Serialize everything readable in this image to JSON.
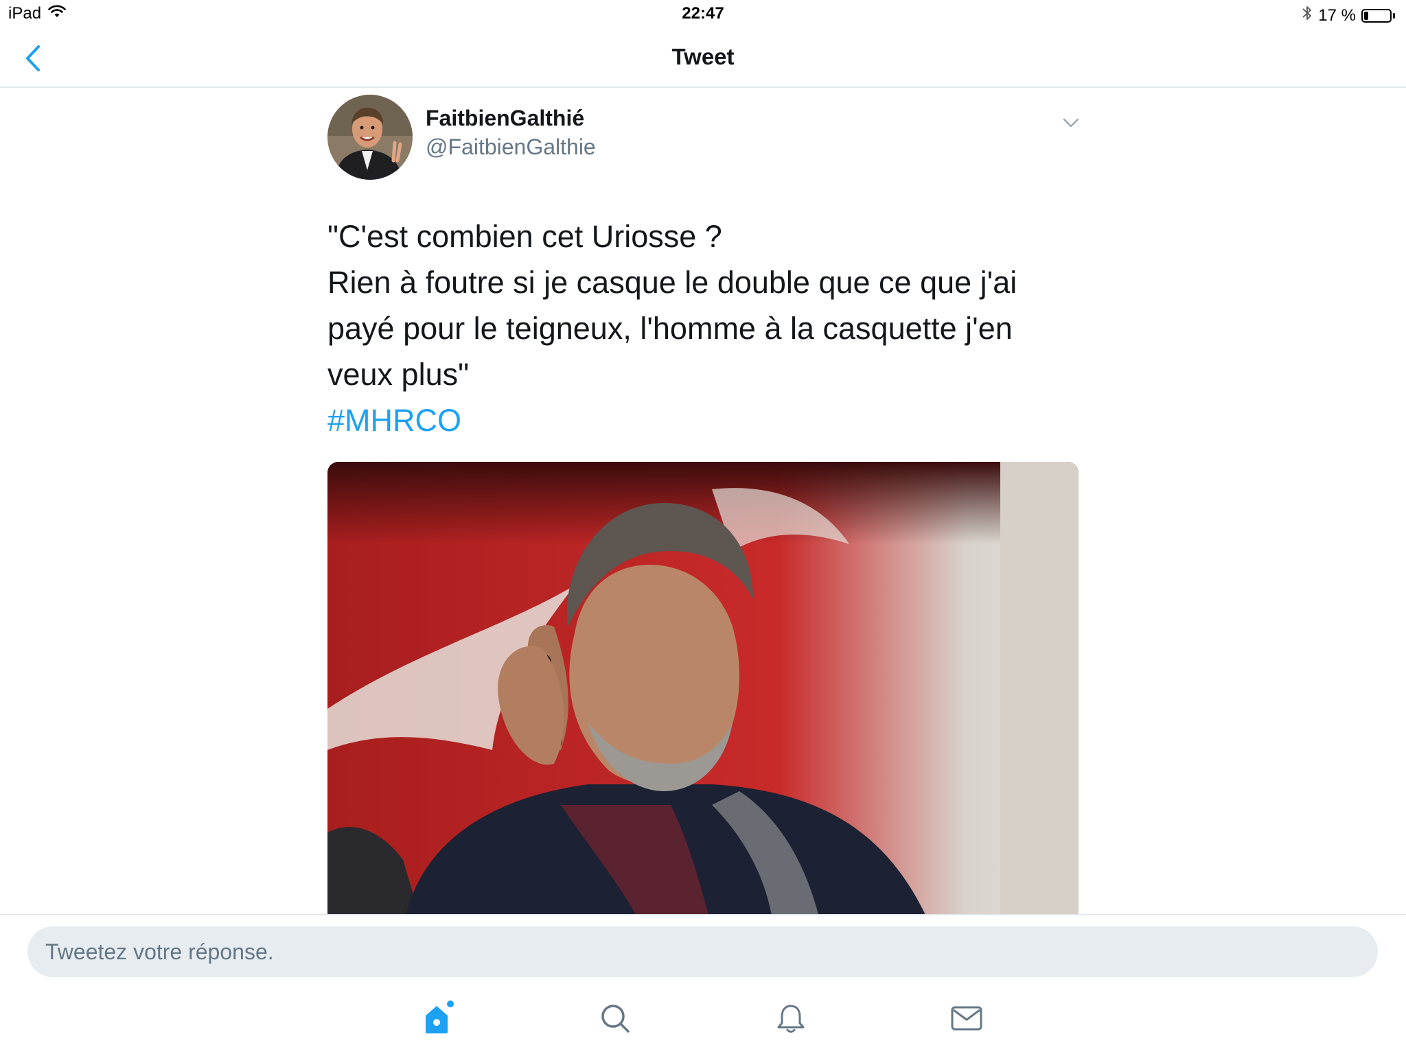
{
  "status_bar": {
    "device": "iPad",
    "time": "22:47",
    "battery_text": "17 %",
    "battery_level": 0.17
  },
  "nav": {
    "title": "Tweet",
    "back_icon": "chevron-left-icon"
  },
  "tweet": {
    "display_name": "FaitbienGalthié",
    "handle": "@FaitbienGalthie",
    "text_lines": [
      "\"C'est combien cet Uriosse ?",
      "Rien à foutre si je casque le double que ce que j'ai",
      "payé pour le teigneux, l'homme à la casquette j'en",
      "veux plus\""
    ],
    "hashtag": "#MHRCO",
    "more_icon": "chevron-down-icon"
  },
  "reply": {
    "placeholder": "Tweetez votre réponse."
  },
  "tabs": [
    {
      "icon": "home-icon"
    },
    {
      "icon": "search-icon"
    },
    {
      "icon": "notifications-icon"
    },
    {
      "icon": "messages-icon"
    }
  ],
  "colors": {
    "accent": "#1da1f2",
    "secondary_text": "#657786",
    "divider": "#e1e8ed",
    "input_bg": "#e6ecf0",
    "icon_gray": "#657786"
  }
}
